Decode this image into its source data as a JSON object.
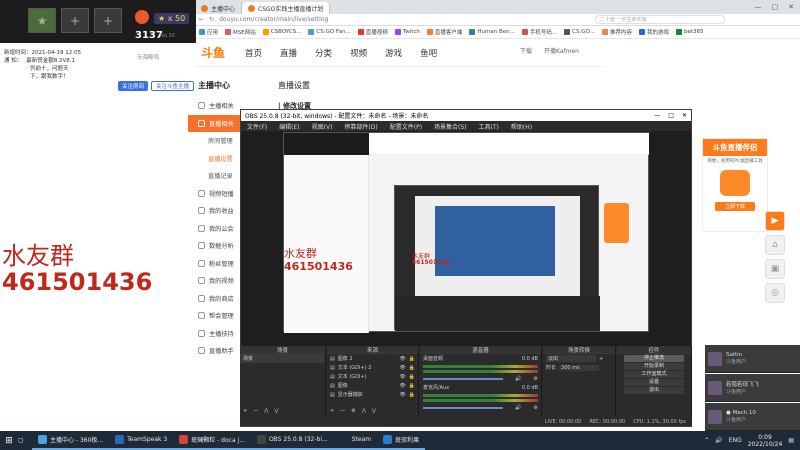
{
  "overlay": {
    "level_badge": "★ x 50",
    "score": "3137",
    "slot_plus": "+",
    "pctlabel": "No.30"
  },
  "streamer_note": {
    "line1": "新增时间：2021-04-19 12:05",
    "line2": "通    知：",
    "line3": "最新赞金额8.2V8.1",
    "line4": "列前十，问题天",
    "line5": "下，跟我数字！",
    "btn_a": "关注房间",
    "btn_b": "关注斗鱼主播",
    "btn_c": "天海鲸鸣"
  },
  "browser": {
    "tabs": [
      {
        "label": "主播中心"
      },
      {
        "label": "CSGO实践主播直播计划"
      }
    ],
    "url": "douyu.com/creator/main/live/setting",
    "search_placeholder": "二十册 一外生命实施",
    "bookmarks": [
      "应用",
      "MSE网站",
      "CSBOYCS...",
      "CS:GO Fan...",
      "直播视频",
      "Twitch",
      "直播客户端",
      "Human Ben...",
      "手机号码...",
      "CS:GO...",
      "推荐内容",
      "我的游戏",
      "bet365"
    ]
  },
  "douyu": {
    "logo": "斗鱼",
    "nav": [
      "首页",
      "直播",
      "分类",
      "视频",
      "游戏",
      "鱼吧"
    ],
    "nav_right": [
      "下载",
      "开播Kafmen"
    ]
  },
  "sidebar": {
    "title": "主播中心",
    "items": [
      {
        "label": "主播相关",
        "type": "top"
      },
      {
        "label": "直播相关",
        "type": "active"
      },
      {
        "label": "房间管理",
        "type": "sub"
      },
      {
        "label": "直播设置",
        "type": "subhl"
      },
      {
        "label": "直播记录",
        "type": "sub"
      },
      {
        "label": "视频短播",
        "type": "top"
      },
      {
        "label": "我的收益",
        "type": "top"
      },
      {
        "label": "我的公会",
        "type": "top"
      },
      {
        "label": "数据分析",
        "type": "top"
      },
      {
        "label": "粉丝管理",
        "type": "top"
      },
      {
        "label": "我的视频",
        "type": "top"
      },
      {
        "label": "我的商店",
        "type": "top"
      },
      {
        "label": "帮会管理",
        "type": "top"
      },
      {
        "label": "主播扶持",
        "type": "top"
      },
      {
        "label": "直播助手",
        "type": "top"
      }
    ]
  },
  "page": {
    "heading": "直播设置",
    "subheading": "| 修改设置"
  },
  "qq_group": {
    "label": "水友群",
    "number": "461501436"
  },
  "ad": {
    "title": "斗鱼直播伴侣",
    "desc": "简便，易用的PC端直播工具",
    "btn": "立即下载"
  },
  "obs": {
    "title": "OBS 25.0.8 (32-bit, windows) - 配置文件：未命名 - 场景：未命名",
    "menu": [
      "文件(F)",
      "编辑(E)",
      "视图(V)",
      "停靠部件(D)",
      "配置文件(P)",
      "场景集合(S)",
      "工具(T)",
      "帮助(H)"
    ],
    "docks": {
      "scenes": "场景",
      "sources": "来源",
      "mixer": "混音器",
      "transitions": "场景转换",
      "controls": "控件"
    },
    "scene_items": [
      "场景"
    ],
    "source_items": [
      "图像 2",
      "文本 (GDI+) 2",
      "文本 (GDI+)",
      "图像",
      "显示器捕获"
    ],
    "mixer_items": [
      {
        "name": "桌面音频",
        "db": "0.0 dB"
      },
      {
        "name": "麦克风/Aux",
        "db": "0.0 dB"
      }
    ],
    "transition": {
      "type": "淡出",
      "duration_label": "时长",
      "duration": "300 ms"
    },
    "controls": [
      "停止推流",
      "开始录制",
      "工作室模式",
      "设置",
      "退出"
    ],
    "status": [
      "LIVE: 00:00:00",
      "REC: 00:00:00",
      "CPU: 1.1%, 30.00 fps"
    ]
  },
  "chat": [
    {
      "name": "Sattin",
      "sub": "斗鱼用户"
    },
    {
      "name": "若隐若现飞飞",
      "sub": "斗鱼用户"
    },
    {
      "name": "● Mach.10",
      "sub": "斗鱼用户"
    }
  ],
  "taskbar": {
    "items": [
      {
        "label": "主播中心 - 360极...",
        "color": "#4aa3df"
      },
      {
        "label": "TeamSpeak 3",
        "color": "#2a6ab5"
      },
      {
        "label": "斑斓颗粒 - doca j...",
        "color": "#d2453a"
      },
      {
        "label": "OBS 25.0.8 (32-bi...",
        "color": "#444"
      },
      {
        "label": "Steam",
        "color": "#1b2838"
      },
      {
        "label": "斑驳利果",
        "color": "#2b7cd3"
      }
    ],
    "time": "0:09",
    "date": "2022/10/24",
    "ime": "ENG"
  }
}
